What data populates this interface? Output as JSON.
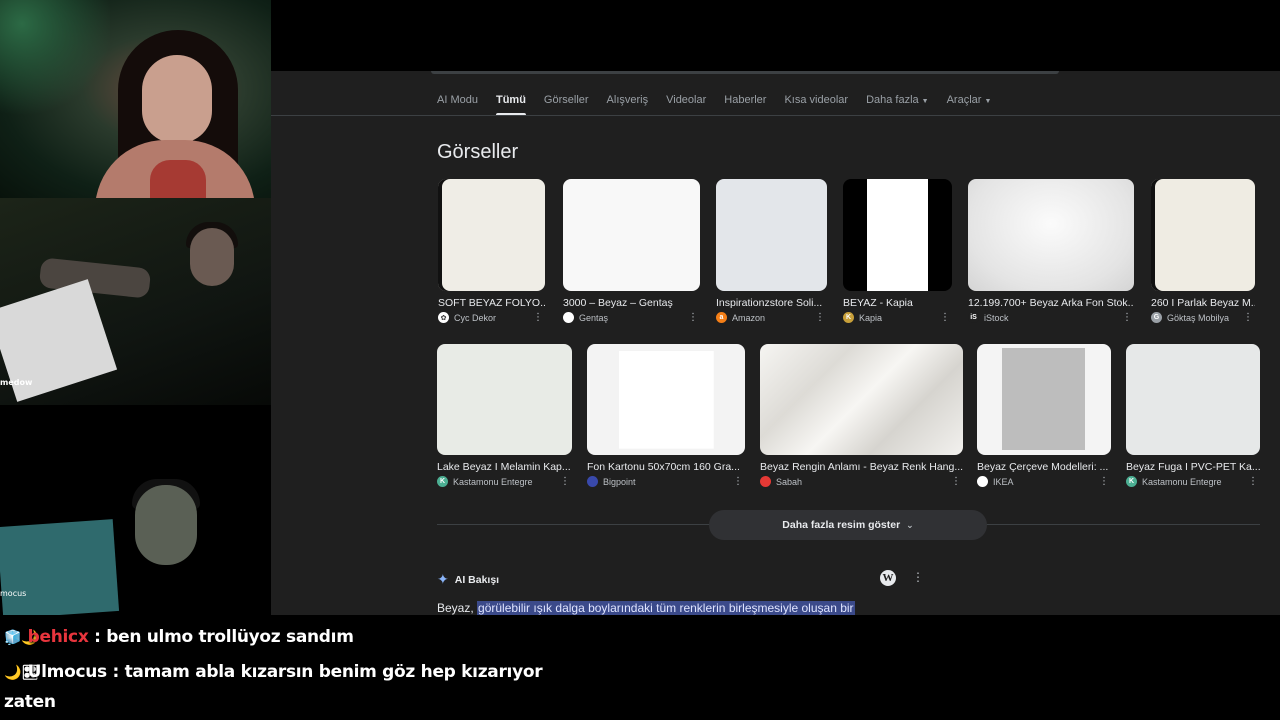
{
  "overlay": {
    "cam2_label": "medow",
    "cam3_label": "mocus"
  },
  "browser": {
    "tabs": [
      {
        "label": "AI Modu",
        "active": false
      },
      {
        "label": "Tümü",
        "active": true
      },
      {
        "label": "Görseller",
        "active": false
      },
      {
        "label": "Alışveriş",
        "active": false
      },
      {
        "label": "Videolar",
        "active": false
      },
      {
        "label": "Haberler",
        "active": false
      },
      {
        "label": "Kısa videolar",
        "active": false
      },
      {
        "label": "Daha fazla",
        "active": false,
        "dropdown": true
      },
      {
        "label": "Araçlar",
        "active": false,
        "dropdown": true
      }
    ],
    "images_title": "Görseller",
    "row1": [
      {
        "caption": "SOFT BEYAZ FOLYO...",
        "source": "Cyc Dekor",
        "fav_color": "#ffffff",
        "fav_glyph": "✿",
        "thumb": "#efede6"
      },
      {
        "caption": "3000 – Beyaz – Gentaş",
        "source": "Gentaş",
        "fav_color": "#ffffff",
        "fav_glyph": "",
        "thumb": "#f8f8f8"
      },
      {
        "caption": "Inspirationzstore Soli...",
        "source": "Amazon",
        "fav_color": "#f57f17",
        "fav_glyph": "a",
        "thumb": "#e3e6ea"
      },
      {
        "caption": "BEYAZ - Kapia",
        "source": "Kapia",
        "fav_color": "#c8a03a",
        "fav_glyph": "K",
        "thumb": "#ffffff"
      },
      {
        "caption": "12.199.700+ Beyaz Arka Fon Stok...",
        "source": "iStock",
        "fav_color": "#1f1f1f",
        "fav_glyph": "iS",
        "thumb": "#eaeaea"
      },
      {
        "caption": "260 I Parlak Beyaz M...",
        "source": "Göktaş Mobilya",
        "fav_color": "#9aa0a6",
        "fav_glyph": "G",
        "thumb": "#efece3"
      }
    ],
    "row2": [
      {
        "caption": "Lake Beyaz I Melamin Kap...",
        "source": "Kastamonu Entegre",
        "fav_color": "#4caf93",
        "fav_glyph": "K",
        "thumb": "#e8ebe6"
      },
      {
        "caption": "Fon Kartonu 50x70cm 160 Gra...",
        "source": "Bigpoint",
        "fav_color": "#3949ab",
        "fav_glyph": "",
        "thumb": "#f7f7f7"
      },
      {
        "caption": "Beyaz Rengin Anlamı - Beyaz Renk Hang...",
        "source": "Sabah",
        "fav_color": "#e53935",
        "fav_glyph": "",
        "thumb": "#ecebe8"
      },
      {
        "caption": "Beyaz Çerçeve Modelleri: ...",
        "source": "IKEA",
        "fav_color": "#ffffff",
        "fav_glyph": "",
        "thumb": "#f0f0f0"
      },
      {
        "caption": "Beyaz Fuga I PVC-PET Ka...",
        "source": "Kastamonu Entegre",
        "fav_color": "#4caf93",
        "fav_glyph": "K",
        "thumb": "#e6e8e8"
      }
    ],
    "more_images_label": "Daha fazla resim göster",
    "ai_overview_label": "AI Bakışı",
    "ai_text_prefix": "Beyaz, ",
    "ai_text_highlight": "görülebilir ışık dalga boylarındaki tüm renklerin birleşmesiyle oluşan bir"
  },
  "chat": [
    {
      "user": "behicx",
      "message": " : ben ulmo trollüyoz sandım",
      "user_color": "#e8353d",
      "badges": "🧊🌙"
    },
    {
      "user": "Ulmocus",
      "message": " : tamam abla kızarsın benim göz hep kızarıyor",
      "user_color": "#ffffff",
      "badges": "🌙🎛",
      "continuation": "zaten"
    }
  ]
}
